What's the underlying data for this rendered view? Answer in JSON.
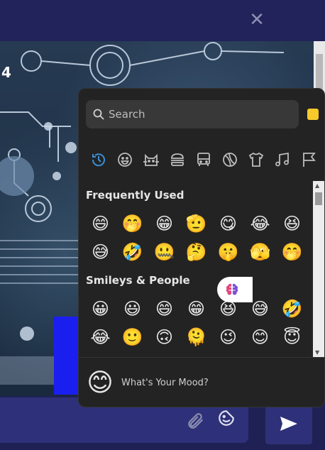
{
  "header": {
    "close_icon": "close-icon"
  },
  "background": {
    "number_text": "4"
  },
  "picker": {
    "search_placeholder": "Search",
    "skin_tone_color": "#f8c92a",
    "categories": [
      {
        "name": "recent",
        "icon": "clock-icon",
        "active": true
      },
      {
        "name": "smileys",
        "icon": "smiley-icon"
      },
      {
        "name": "animals",
        "icon": "cat-icon"
      },
      {
        "name": "food",
        "icon": "burger-icon"
      },
      {
        "name": "travel",
        "icon": "bus-icon"
      },
      {
        "name": "activities",
        "icon": "ball-icon"
      },
      {
        "name": "objects",
        "icon": "shirt-icon"
      },
      {
        "name": "symbols",
        "icon": "music-icon"
      },
      {
        "name": "flags",
        "icon": "flag-icon"
      }
    ],
    "sections": [
      {
        "title": "Frequently Used",
        "emojis": [
          "😄",
          "🤭",
          "😁",
          "🫡",
          "😋",
          "😂",
          "😆",
          "😅",
          "🤣",
          "🤐",
          "🤔",
          "🤫",
          "🫣",
          "🤭"
        ]
      },
      {
        "title": "Smileys & People",
        "emojis": [
          "😀",
          "😃",
          "😄",
          "😁",
          "😆",
          "😅",
          "🤣",
          "😂",
          "🙂",
          "🙃",
          "🫠",
          "😉",
          "😊",
          "😇"
        ]
      }
    ],
    "footer": {
      "preview_emoji": "😊",
      "preview_text": "What's Your Mood?",
      "mood_icon": "brain-icon"
    }
  },
  "composer": {
    "attach_icon": "paperclip-icon",
    "sticker_icon": "sticker-icon",
    "send_icon": "send-icon"
  },
  "colors": {
    "accent": "#2e3179",
    "active_category": "#3b8fd6",
    "picker_bg": "#232323"
  }
}
